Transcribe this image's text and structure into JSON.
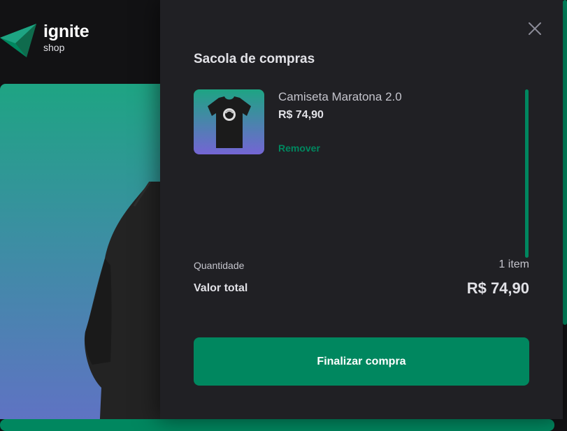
{
  "brand": {
    "title": "ignite",
    "subtitle": "shop",
    "accent_color": "#00875f"
  },
  "background": {
    "product_image_icon": "tshirt-icon"
  },
  "cart": {
    "title": "Sacola de compras",
    "close_icon": "close-icon",
    "items": [
      {
        "name": "Camiseta Maratona 2.0",
        "price": "R$ 74,90",
        "remove_label": "Remover",
        "image_icon": "tshirt-icon"
      }
    ],
    "summary": {
      "quantity_label": "Quantidade",
      "quantity_value": "1 item",
      "total_label": "Valor total",
      "total_value": "R$ 74,90"
    },
    "checkout_label": "Finalizar compra"
  }
}
